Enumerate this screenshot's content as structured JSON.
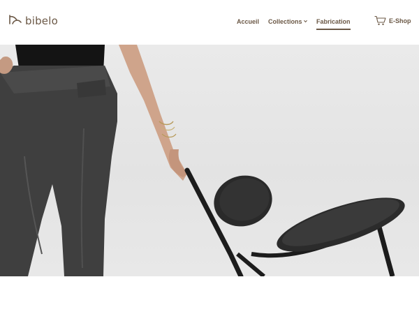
{
  "brand": {
    "name": "bibelo",
    "icon": "bibelo-logo-mark-icon"
  },
  "nav": {
    "items": [
      {
        "label": "Accueil"
      },
      {
        "label": "Collections",
        "icon": "chevron-down-icon"
      },
      {
        "label": "Fabrication",
        "active": true
      }
    ]
  },
  "shop": {
    "label": "E-Shop",
    "icon": "cart-icon"
  },
  "colors": {
    "brand": "#6b5846",
    "hero_background": "#e6e6e6"
  }
}
